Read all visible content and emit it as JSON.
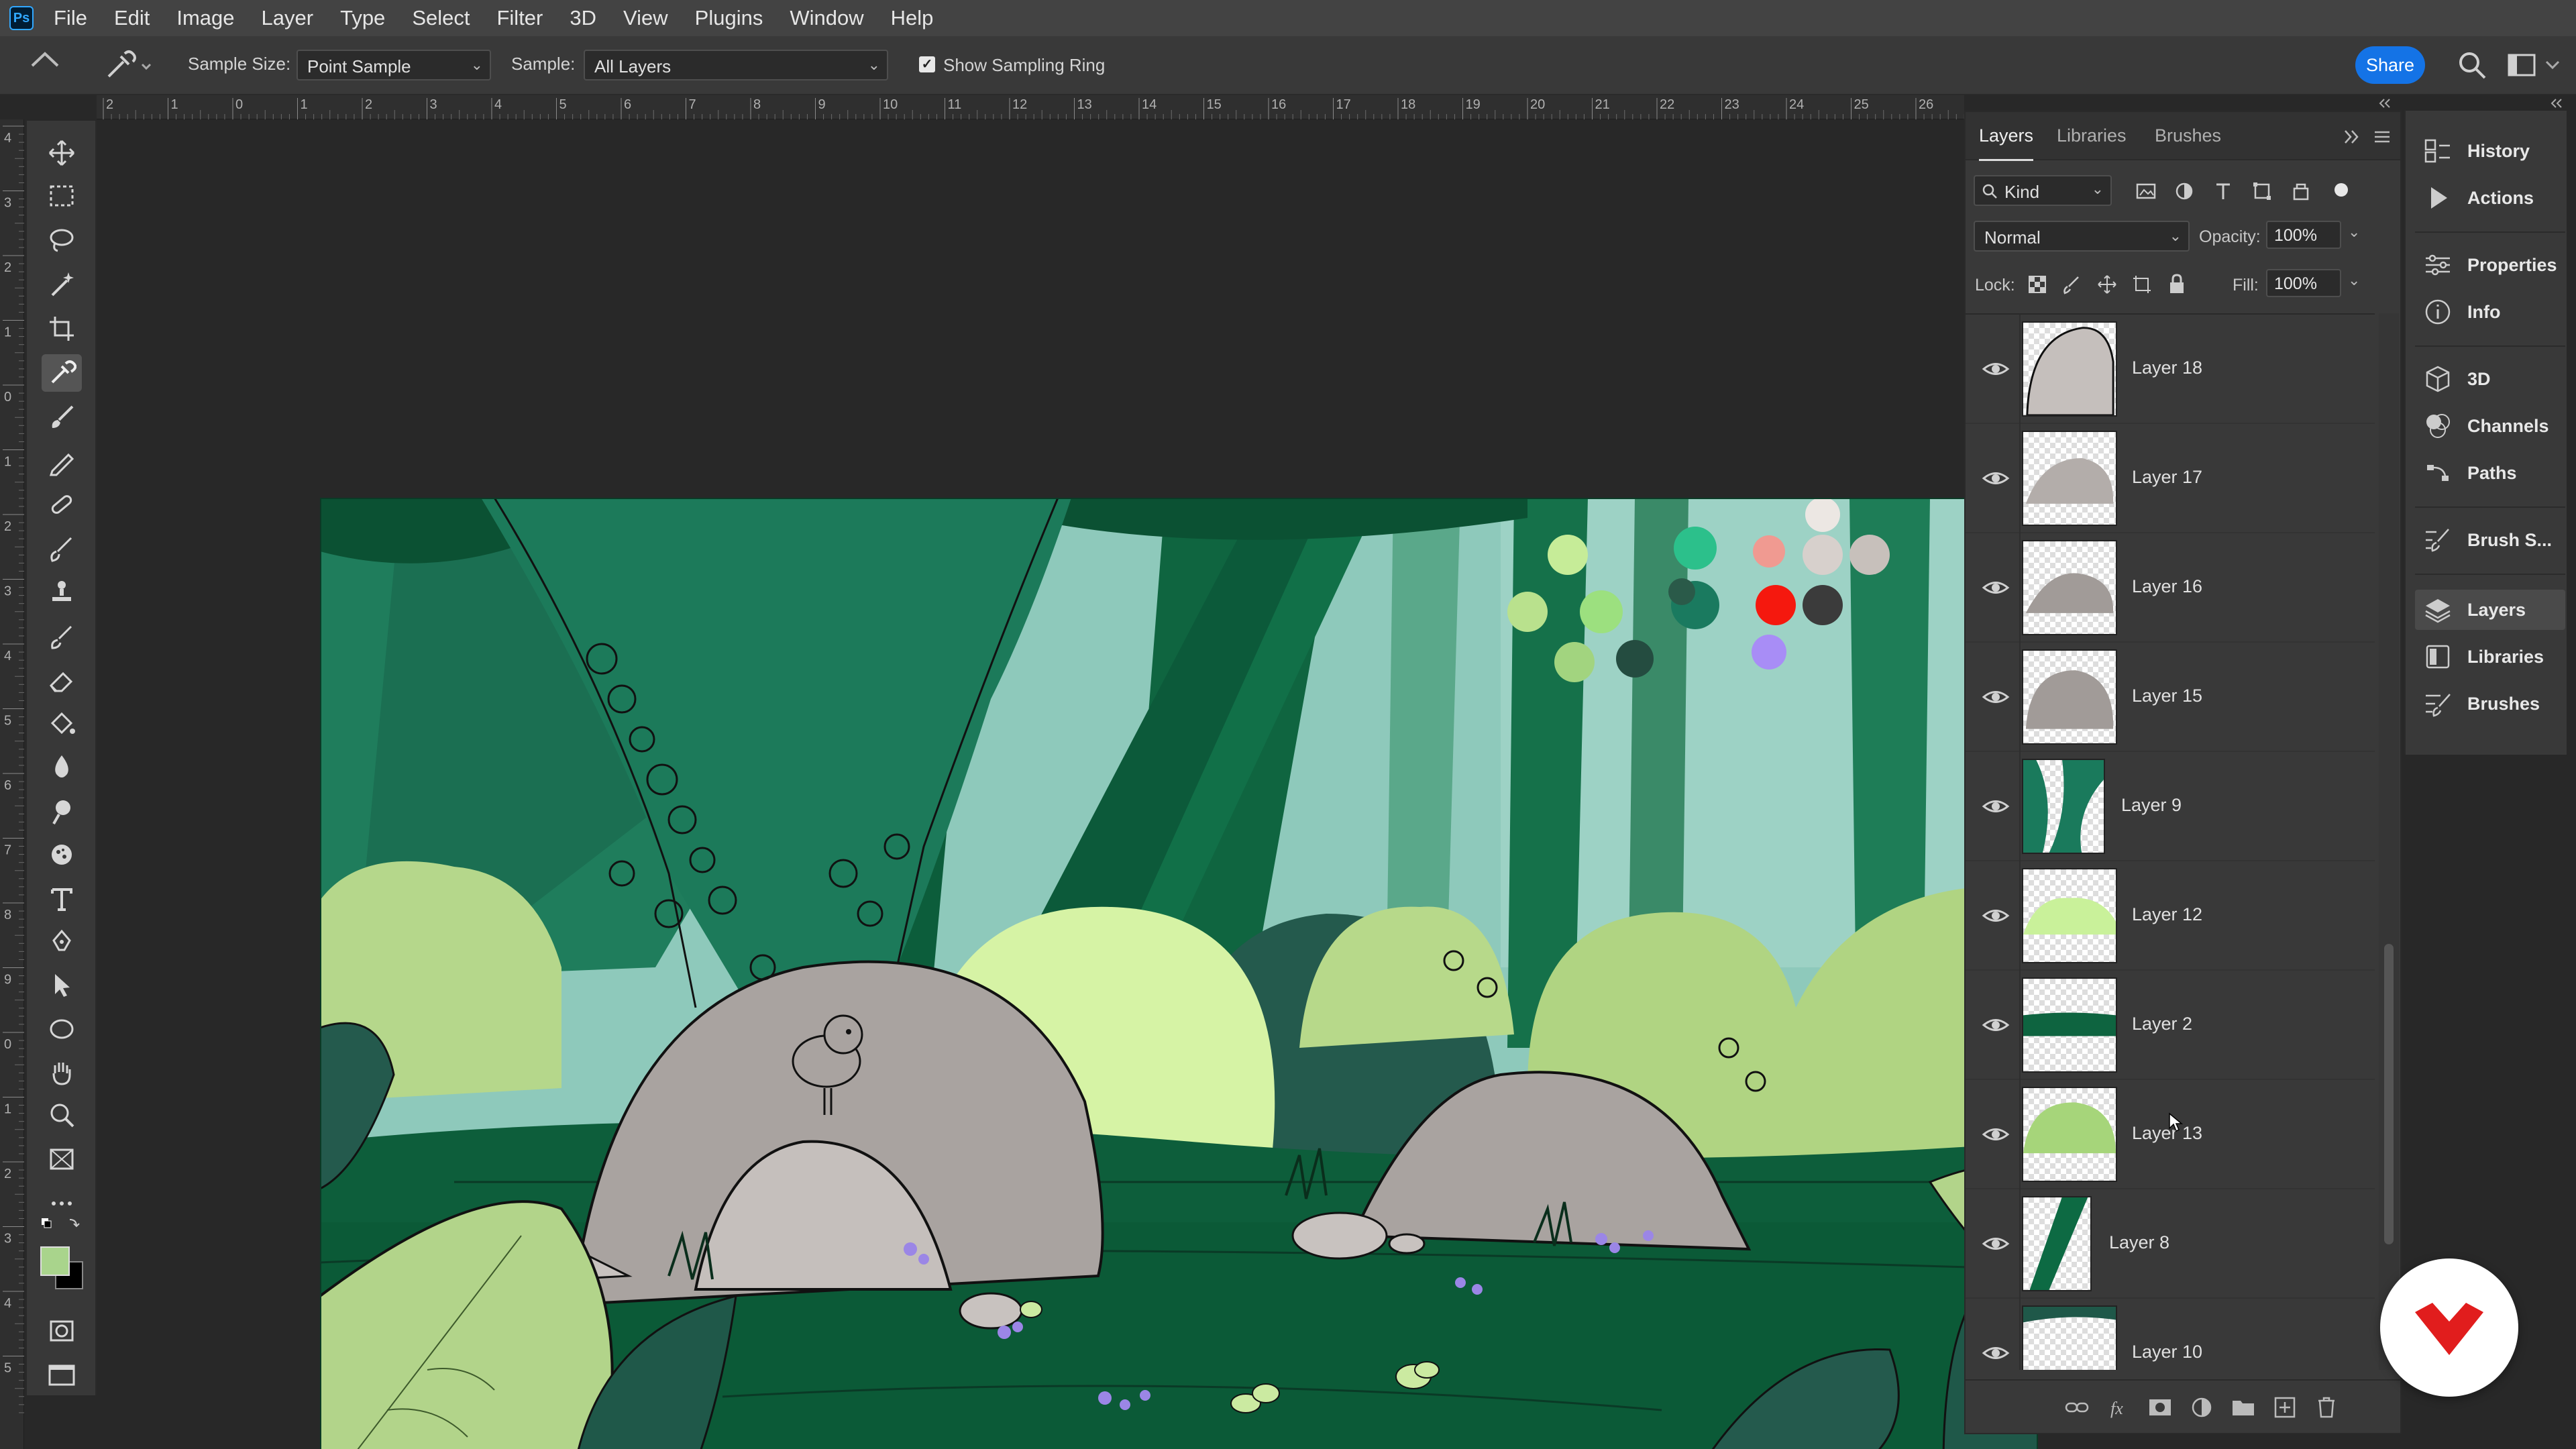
{
  "app": {
    "logo_text": "Ps"
  },
  "menubar": {
    "items": [
      "File",
      "Edit",
      "Image",
      "Layer",
      "Type",
      "Select",
      "Filter",
      "3D",
      "View",
      "Plugins",
      "Window",
      "Help"
    ]
  },
  "options": {
    "sample_size_label": "Sample Size:",
    "sample_size_value": "Point Sample",
    "sample_label": "Sample:",
    "sample_value": "All Layers",
    "sampling_ring_label": "Show Sampling Ring",
    "sampling_ring_checked": true,
    "share_label": "Share"
  },
  "rulers": {
    "top_labels": [
      "2",
      "1",
      "0",
      "1",
      "2",
      "3",
      "4",
      "5",
      "6",
      "7",
      "8",
      "9",
      "10",
      "11",
      "12",
      "13",
      "14",
      "15",
      "16",
      "17",
      "18",
      "19",
      "20",
      "21",
      "22",
      "23",
      "24",
      "25",
      "26"
    ],
    "left_labels": [
      "4",
      "3",
      "2",
      "1",
      "0",
      "1",
      "2",
      "3",
      "4",
      "5",
      "6",
      "7",
      "8",
      "9",
      "0",
      "1",
      "2",
      "3",
      "4",
      "5"
    ]
  },
  "toolbar": {
    "tools": [
      "move-tool",
      "marquee-tool",
      "lasso-tool",
      "magic-wand-tool",
      "crop-tool",
      "eyedropper-tool",
      "brush-tool",
      "pencil-tool",
      "healing-tool",
      "mixer-brush-tool",
      "clone-stamp-tool",
      "history-brush-tool",
      "eraser-tool",
      "paint-bucket-tool",
      "blur-tool",
      "dodge-tool",
      "sponge-tool",
      "type-tool",
      "pen-tool",
      "path-selection-tool",
      "ellipse-tool",
      "hand-tool",
      "zoom-tool",
      "frame-tool",
      "more-tools"
    ],
    "active_tool": "eyedropper-tool",
    "foreground_color": "#a9d48c",
    "background_color": "#000000"
  },
  "layers_panel": {
    "tabs": [
      "Layers",
      "Libraries",
      "Brushes"
    ],
    "active_tab": "Layers",
    "filter_kind": "Kind",
    "blend_mode": "Normal",
    "opacity_label": "Opacity:",
    "opacity_value": "100%",
    "lock_label": "Lock:",
    "fill_label": "Fill:",
    "fill_value": "100%",
    "layers": [
      {
        "name": "Layer 18",
        "thumb": "rock-light"
      },
      {
        "name": "Layer 17",
        "thumb": "rock-mid"
      },
      {
        "name": "Layer 16",
        "thumb": "rock-dark"
      },
      {
        "name": "Layer 15",
        "thumb": "rock-dark2"
      },
      {
        "name": "Layer 9",
        "thumb": "trunk"
      },
      {
        "name": "Layer 12",
        "thumb": "bush-light"
      },
      {
        "name": "Layer 2",
        "thumb": "ground-strip"
      },
      {
        "name": "Layer 13",
        "thumb": "bush-green"
      },
      {
        "name": "Layer 8",
        "thumb": "trunk-thin"
      },
      {
        "name": "Layer 10",
        "thumb": "ground-bottom"
      }
    ]
  },
  "dock": {
    "items": [
      "History",
      "Actions",
      "Properties",
      "Info",
      "3D",
      "Channels",
      "Paths",
      "Brush S...",
      "Layers",
      "Libraries",
      "Brushes"
    ],
    "active": "Layers"
  },
  "palette_swatches": [
    "#c6ec98",
    "#b9e18d",
    "#9ce07f",
    "#a2d47f",
    "#2cc08b",
    "#1a7a5f",
    "#2a5a49",
    "#244c40",
    "#f09a91",
    "#f5180e",
    "#a88df6",
    "#ece7e3",
    "#d7d0cc",
    "#c7c0bb",
    "#3b3b3b"
  ],
  "colors": {
    "accent": "#1473e6",
    "forest_dark": "#0c5a3a",
    "forest_mid": "#1e7d5b",
    "sky": "#8ec9bb",
    "rock": "#a9a3a0",
    "leaf_light": "#b7d98a"
  }
}
